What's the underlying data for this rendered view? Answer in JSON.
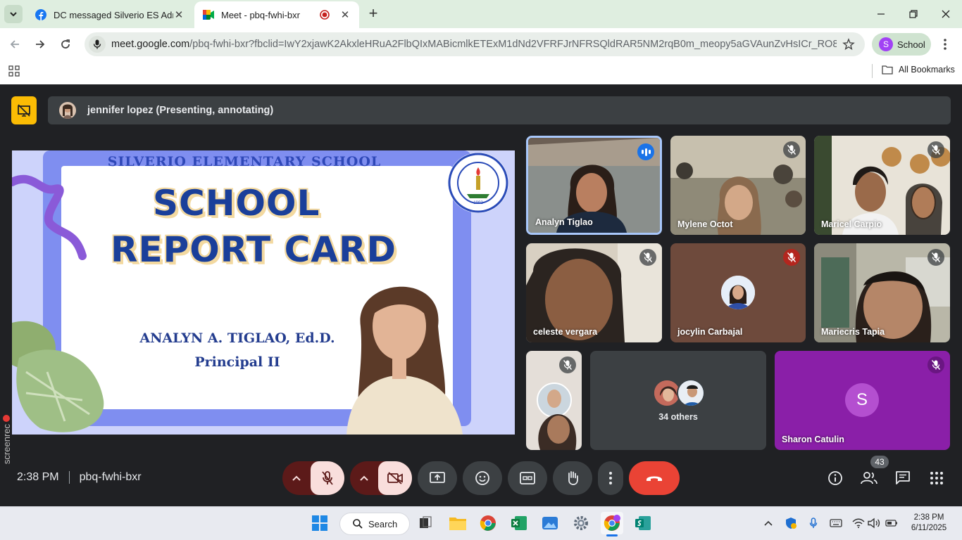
{
  "browser": {
    "tabs": [
      {
        "title": "DC messaged Silverio ES Admin",
        "icon": "facebook-icon"
      },
      {
        "title": "Meet - pbq-fwhi-bxr",
        "icon": "google-meet-icon",
        "recording": true
      }
    ],
    "url_domain": "meet.google.com",
    "url_path": "/pbq-fwhi-bxr?fbclid=IwY2xjawK2AkxleHRuA2FlbQIxMABicmlkETExM1dNd2VFRFJrNFRSQldRAR5NM2rqB0m_meopy5aGVAunZvHsICr_RO829jMxA4...",
    "profile_initial": "S",
    "profile_label": "School",
    "bookmarks_label": "All Bookmarks"
  },
  "meet": {
    "presenter_bar": "jennifer lopez (Presenting, annotating)",
    "slide": {
      "school": "SILVERIO ELEMENTARY SCHOOL",
      "line1": "SCHOOL",
      "line2": "REPORT CARD",
      "name": "ANALYN A. TIGLAO, Ed.D.",
      "position": "Principal II",
      "seal_text": "SILVERIO ELEMENTARY SCHOOL",
      "seal_bottom": "PARAÑAQUE CITY",
      "seal_year": "1992"
    },
    "participants": [
      {
        "name": "Analyn Tiglao",
        "speaking": true
      },
      {
        "name": "Mylene Octot",
        "muted": true
      },
      {
        "name": "Maricel Carpio",
        "muted": true
      },
      {
        "name": "celeste vergara",
        "muted": true
      },
      {
        "name": "jocylin Carbajal",
        "muted": true
      },
      {
        "name": "Mariecris Tapia",
        "muted": true
      },
      {
        "name": "",
        "muted": true
      },
      {
        "name": "Sharon Catulin",
        "initial": "S",
        "muted": true
      }
    ],
    "others_label": "34 others",
    "time": "2:38 PM",
    "meeting_code": "pbq-fwhi-bxr",
    "people_count": "43",
    "recorder_label": "screenrec"
  },
  "taskbar": {
    "search_label": "Search",
    "time": "2:38 PM",
    "date": "6/11/2025"
  },
  "colors": {
    "accent_blue": "#1a73e8",
    "end_call": "#ea4335",
    "presenting_flag": "#fbbc04",
    "meet_bg": "#202124"
  }
}
